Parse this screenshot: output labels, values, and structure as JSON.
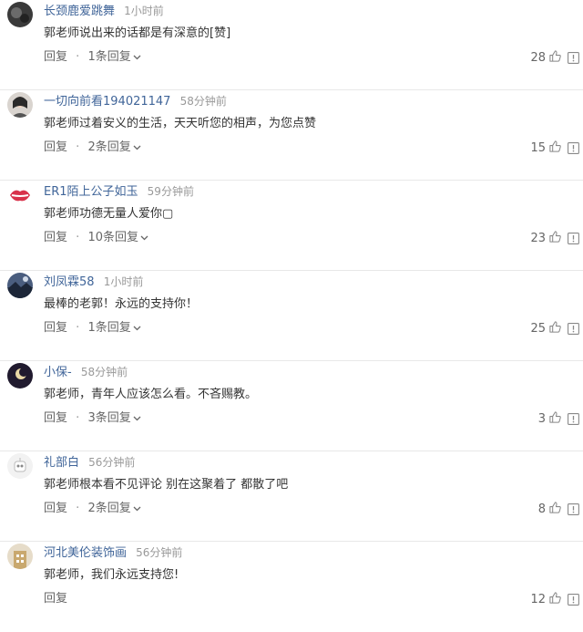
{
  "ui": {
    "reply_label": "回复",
    "separator": "·"
  },
  "comments": [
    {
      "username": "长颈鹿爱跳舞",
      "time": "1小时前",
      "text": "郭老师说出来的话都是有深意的[赞]",
      "replies": "1条回复",
      "likes": "28",
      "avatar": "dark-circle"
    },
    {
      "username": "一切向前看194021147",
      "time": "58分钟前",
      "text": "郭老师过着安义的生活，天天听您的相声，为您点赞",
      "replies": "2条回复",
      "likes": "15",
      "avatar": "portrait"
    },
    {
      "username": "ER1陌上公子如玉",
      "time": "59分钟前",
      "text": "郭老师功德无量人爱你▢",
      "replies": "10条回复",
      "likes": "23",
      "avatar": "red-lips"
    },
    {
      "username": "刘凤霖58",
      "time": "1小时前",
      "text": "最棒的老郭！永远的支持你！",
      "replies": "1条回复",
      "likes": "25",
      "avatar": "landscape"
    },
    {
      "username": "小保-",
      "time": "58分钟前",
      "text": "郭老师，青年人应该怎么看。不吝赐教。",
      "replies": "3条回复",
      "likes": "3",
      "avatar": "dark-moon"
    },
    {
      "username": "礼部白",
      "time": "56分钟前",
      "text": "郭老师根本看不见评论 别在这聚着了 都散了吧",
      "replies": "2条回复",
      "likes": "8",
      "avatar": "default-robot"
    },
    {
      "username": "河北美伦装饰画",
      "time": "56分钟前",
      "text": "郭老师，我们永远支持您!",
      "replies": "",
      "likes": "12",
      "avatar": "building"
    }
  ]
}
